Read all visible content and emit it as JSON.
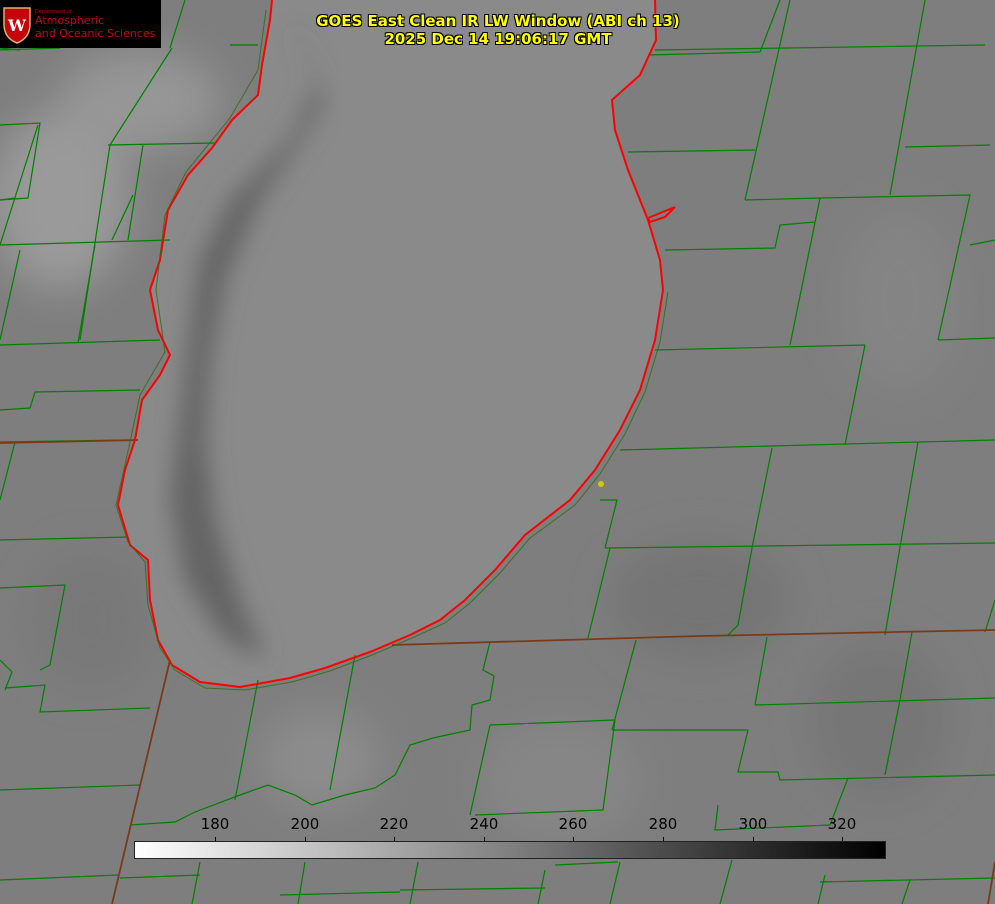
{
  "logo": {
    "dept_line": "Department of",
    "line1": "Atmospheric",
    "line2": "and Oceanic Sciences",
    "shield_letter": "W",
    "colors": {
      "background": "#000000",
      "text": "#c5050c",
      "shield": "#c5050c"
    }
  },
  "title": {
    "line1": "GOES East Clean IR LW Window (ABI ch 13)",
    "line2": "2025 Dec 14 19:06:17 GMT",
    "color": "#ffff00"
  },
  "colorbar": {
    "ticks": [
      "180",
      "200",
      "220",
      "240",
      "260",
      "280",
      "300",
      "320"
    ],
    "gradient": [
      "#ffffff",
      "#000000"
    ]
  },
  "map": {
    "colors": {
      "background": "#7e7e7e",
      "lake": "#8a8a8a",
      "county_lines": "#008000",
      "state_lines": "#7a3a1a",
      "shoreline": "#ff0000",
      "marker": "#cccc00"
    }
  }
}
